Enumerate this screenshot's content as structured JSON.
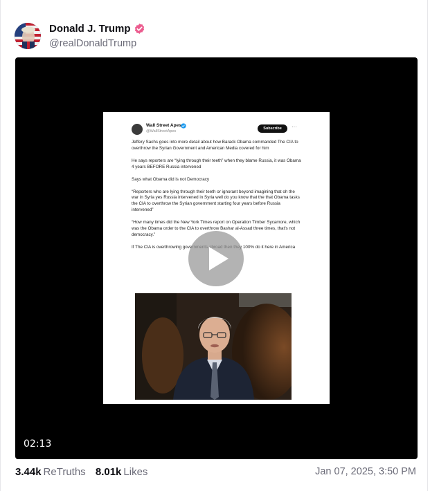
{
  "post": {
    "author": {
      "display_name": "Donald J. Trump",
      "handle": "@realDonaldTrump",
      "verified_icon": "verified-badge-icon",
      "verified_color": "#ec5b8e"
    },
    "media": {
      "duration": "02:13",
      "play_icon": "play-icon",
      "embedded_post": {
        "author_name": "Wall Street Apes",
        "author_handle": "@WallStreetApes",
        "subscribe_label": "Subscribe",
        "more_label": "···",
        "paragraphs": [
          "Jeffery Sachs goes into more detail about how Barack Obama commanded The CIA to overthrow the Syrian Government and American Media covered for him",
          "He says reporters are “lying through their teeth” when they blame Russia, it was Obama 4 years BEFORE Russia intervened",
          "Says what Obama did is not Democracy",
          "“Reporters who are lying through their teeth or ignorant beyond imagining that oh the war in Syria yes Russia intervened in Syria well do you know that the that Obama tasks the CIA to overthrow the Syrian government starting four years before Russia intervened”",
          "“How many times did the New York Times report on Operation Timber Sycamore, which was the Obama order to the CIA to overthrow Bashar al-Assad three times, that’s not democracy.”",
          "If The CIA is overthrowing governments abroad then they 100% do it here in America"
        ]
      }
    },
    "stats": {
      "retruths_count": "3.44k",
      "retruths_label": "ReTruths",
      "likes_count": "8.01k",
      "likes_label": "Likes"
    },
    "timestamp": "Jan 07, 2025, 3:50 PM"
  }
}
